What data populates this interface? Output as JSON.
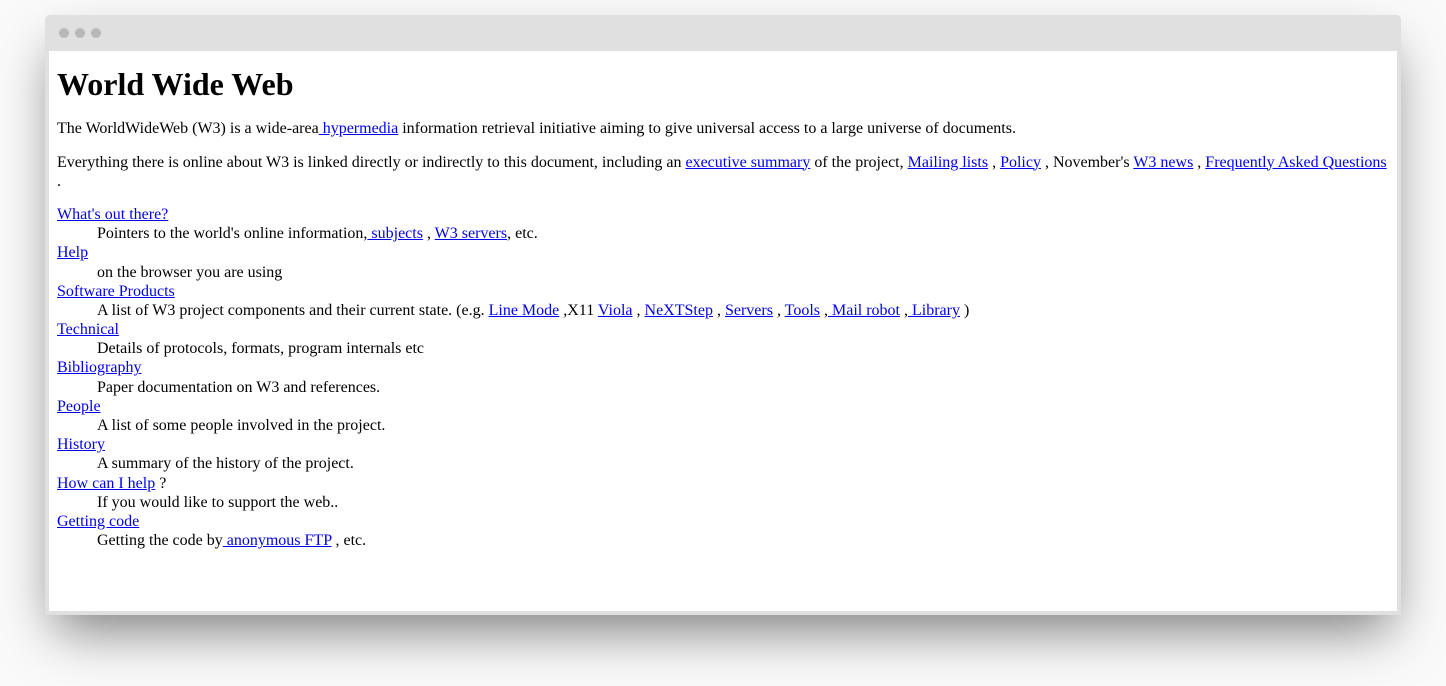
{
  "title": "World Wide Web",
  "intro": {
    "pre": "The WorldWideWeb (W3) is a wide-area",
    "link": " hypermedia",
    "post": " information retrieval initiative aiming to give universal access to a large universe of documents."
  },
  "para2": {
    "s1": "Everything there is online about W3 is linked directly or indirectly to this document, including an ",
    "exec": "executive summary",
    "s2": " of the project, ",
    "ml": "Mailing lists",
    "s3": " , ",
    "pol": "Policy",
    "s4": " , November's ",
    "news": "W3 news",
    "s5": " , ",
    "faq": "Frequently Asked Questions",
    "s6": " ."
  },
  "items": [
    {
      "term": "What's out there?",
      "termSuffix": "",
      "desc": {
        "parts": [
          {
            "t": "Pointers to the world's online information,"
          },
          {
            "a": " subjects"
          },
          {
            "t": " , "
          },
          {
            "a": "W3 servers"
          },
          {
            "t": ", etc."
          }
        ]
      }
    },
    {
      "term": "Help",
      "termSuffix": "",
      "desc": {
        "parts": [
          {
            "t": "on the browser you are using"
          }
        ]
      }
    },
    {
      "term": "Software Products",
      "termSuffix": "",
      "desc": {
        "parts": [
          {
            "t": "A list of W3 project components and their current state. (e.g. "
          },
          {
            "a": "Line Mode"
          },
          {
            "t": " ,X11 "
          },
          {
            "a": "Viola"
          },
          {
            "t": " , "
          },
          {
            "a": "NeXTStep"
          },
          {
            "t": " , "
          },
          {
            "a": "Servers"
          },
          {
            "t": " , "
          },
          {
            "a": "Tools"
          },
          {
            "t": " ,"
          },
          {
            "a": " Mail robot"
          },
          {
            "t": " ,"
          },
          {
            "a": " Library"
          },
          {
            "t": " )"
          }
        ]
      }
    },
    {
      "term": "Technical",
      "termSuffix": "",
      "desc": {
        "parts": [
          {
            "t": "Details of protocols, formats, program internals etc"
          }
        ]
      }
    },
    {
      "term": "Bibliography",
      "termSuffix": "",
      "desc": {
        "parts": [
          {
            "t": "Paper documentation on W3 and references."
          }
        ]
      }
    },
    {
      "term": "People",
      "termSuffix": "",
      "desc": {
        "parts": [
          {
            "t": "A list of some people involved in the project."
          }
        ]
      }
    },
    {
      "term": "History",
      "termSuffix": "",
      "desc": {
        "parts": [
          {
            "t": "A summary of the history of the project."
          }
        ]
      }
    },
    {
      "term": "How can I help",
      "termSuffix": " ?",
      "desc": {
        "parts": [
          {
            "t": "If you would like to support the web.."
          }
        ]
      }
    },
    {
      "term": "Getting code",
      "termSuffix": "",
      "desc": {
        "parts": [
          {
            "t": "Getting the code by"
          },
          {
            "a": " anonymous FTP"
          },
          {
            "t": " , etc."
          }
        ]
      }
    }
  ]
}
